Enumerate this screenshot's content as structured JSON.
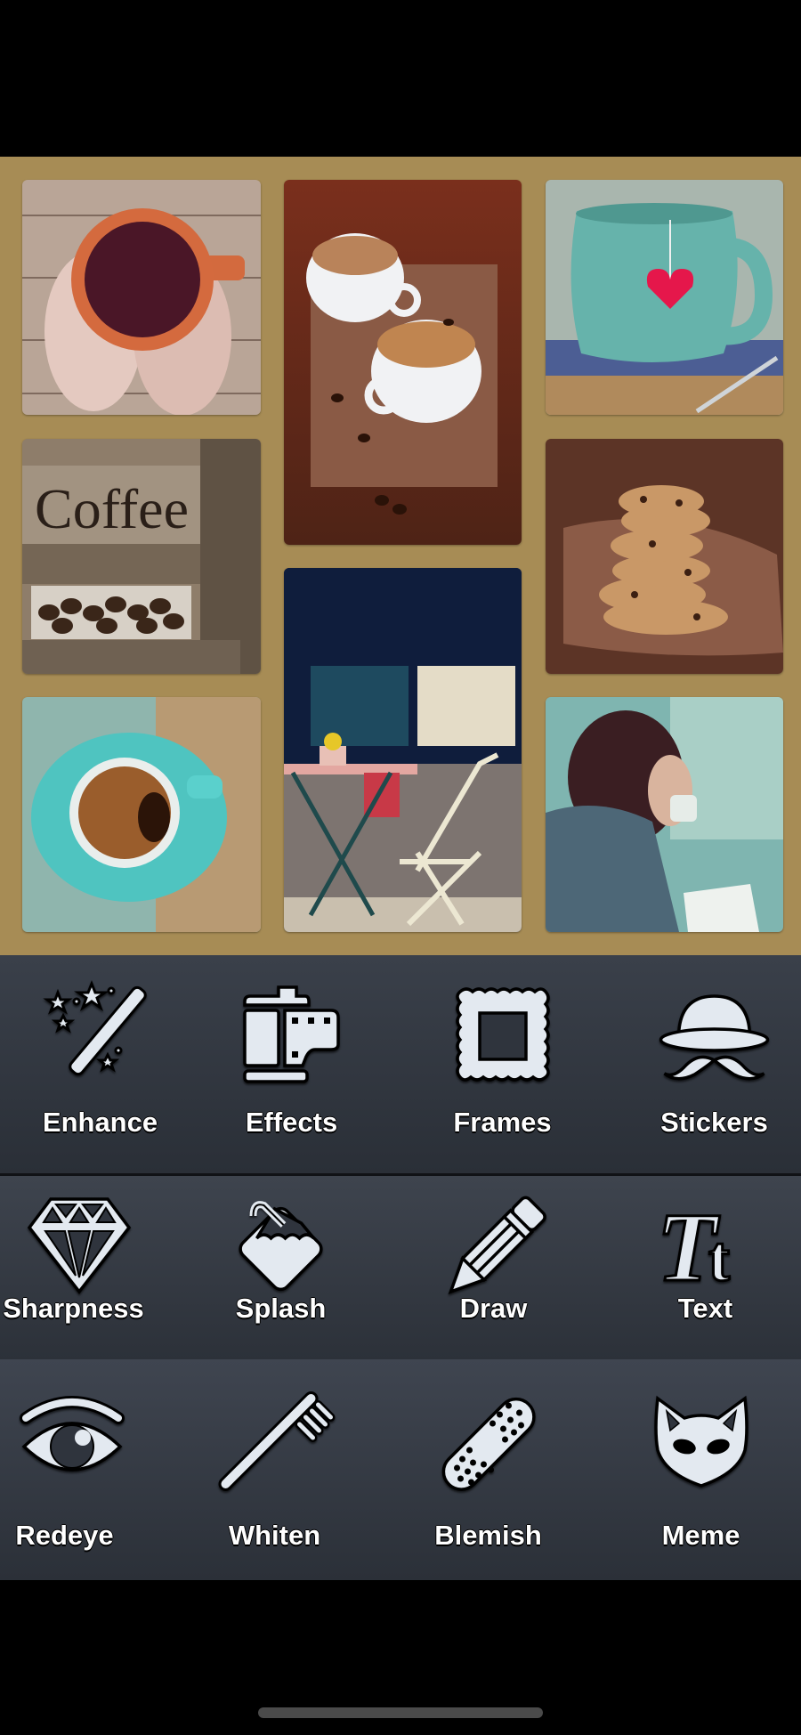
{
  "collage": {
    "background_color": "#a78c55",
    "photos": [
      {
        "subject": "hands holding orange mug"
      },
      {
        "subject": "two espresso cups on burlap"
      },
      {
        "subject": "teal mug with heart tea tag"
      },
      {
        "subject": "Coffee bean drawer",
        "sign_text": "Coffee"
      },
      {
        "subject": "street cafe table and chair"
      },
      {
        "subject": "stack of chocolate chip cookies"
      },
      {
        "subject": "teal cup of coffee on saucer"
      },
      {
        "subject": "woman drinking from cup by window"
      }
    ]
  },
  "tools": {
    "row1": [
      {
        "label": "Enhance",
        "icon": "magic-wand-icon"
      },
      {
        "label": "Effects",
        "icon": "film-canister-icon"
      },
      {
        "label": "Frames",
        "icon": "stamp-frame-icon"
      },
      {
        "label": "Stickers",
        "icon": "hat-mustache-icon"
      }
    ],
    "row2": [
      {
        "label": "Sharpness",
        "icon": "diamond-icon"
      },
      {
        "label": "Splash",
        "icon": "paint-bucket-icon"
      },
      {
        "label": "Draw",
        "icon": "pencil-icon"
      },
      {
        "label": "Text",
        "icon": "text-tt-icon"
      }
    ],
    "row3": [
      {
        "label": "Redeye",
        "icon": "eye-icon"
      },
      {
        "label": "Whiten",
        "icon": "toothbrush-icon"
      },
      {
        "label": "Blemish",
        "icon": "bandage-icon"
      },
      {
        "label": "Meme",
        "icon": "cat-mask-icon"
      }
    ]
  },
  "colors": {
    "tray_bg": "#343a43",
    "icon_fill": "#e3e9f0",
    "label": "#ffffff"
  }
}
